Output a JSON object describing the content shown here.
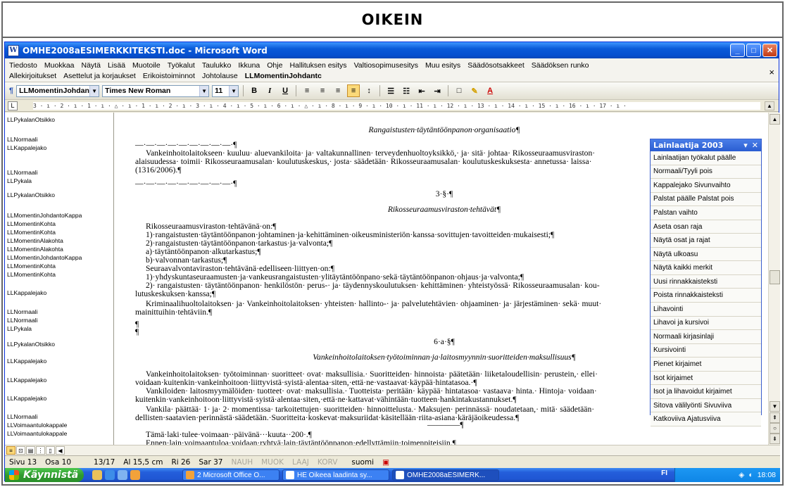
{
  "banner": {
    "title": "OIKEIN"
  },
  "window": {
    "title": "OMHE2008aESIMERKKITEKSTI.doc - Microsoft Word",
    "app_icon_letter": "W",
    "min_label": "_",
    "max_label": "□",
    "close_label": "✕"
  },
  "menu": {
    "row1": [
      "Tiedosto",
      "Muokkaa",
      "Näytä",
      "Lisää",
      "Muotoile",
      "Työkalut",
      "Taulukko",
      "Ikkuna",
      "Ohje",
      "Hallituksen esitys",
      "Valtiosopimusesitys",
      "Muu esitys",
      "Säädösotsakkeet",
      "Säädöksen runko"
    ],
    "row2": [
      "Allekirjoitukset",
      "Asettelut ja korjaukset",
      "Erikoistoiminnot",
      "Johtolause"
    ],
    "row2_style_box": "LLMomentinJohdantc",
    "close_label": "×"
  },
  "toolbar": {
    "style_value": "LLMomentinJohdantc",
    "font_value": "Times New Roman",
    "size_value": "11",
    "bold": "B",
    "italic": "I",
    "underline": "U",
    "dropdown_arrow": "▼"
  },
  "ruler": {
    "tab_selector": "L",
    "scale": "3 · ı · 2 · ı · 1 · ı · △ · ı · 1 · ı · 2 · ı · 3 · ı · 4 · ı · 5 · ı · 6 · ı · △ · ı · 8 · ı · 9 · ı · 10 · ı · 11 · ı · 12 · ı · 13 · ı · 14 · ı · 15 · ı · 16 · ı · 17 · ı ·",
    "collapse": "▲"
  },
  "styles": [
    "LLPykalanOtsikko",
    "LLNormaali",
    "LLKappalejako",
    "LLNormaali",
    "LLPykala",
    "LLPykalanOtsikko",
    "LLMomentinJohdantoKappa",
    "LLMomentinKohta",
    "LLMomentinKohta",
    "LLMomentinAlakohta",
    "LLMomentinAlakohta",
    "LLMomentinJohdantoKappa",
    "LLMomentinKohta",
    "LLMomentinKohta",
    "LLKappalejako",
    "LLNormaali",
    "LLNormaali",
    "LLPykala",
    "LLPykalanOtsikko",
    "LLKappalejako",
    "LLKappalejako",
    "LLKappalejako",
    "LLNormaali",
    "LLVoimaantulokappale",
    "LLVoimaantulokappale"
  ],
  "doc": {
    "l1": "Rangaistusten·täytäntöönpanon·organisaatio¶",
    "l2": "—·—·—·—·—·—·—·—·—·¶",
    "l3": "Vankeinhoitolaitokseen· kuuluu· aluevankiloita· ja· valtakunnallinen· terveydenhuoltoyksikkö,· ja· sitä· johtaa· Rikosseuraamusviraston·",
    "l4": "alaisuudessa· toimii· Rikosseuraamusalan· koulutuskeskus,· josta· säädetään· Rikosseuraamusalan· koulutuskeskuksesta· annetussa· laissa·",
    "l5": "(1316/2006).¶",
    "l6": "—·—·—·—·—·—·—·—·—·¶",
    "l7": "3·§·¶",
    "l8": "Rikosseuraamusviraston·tehtävät¶",
    "l9": "Rikosseuraamusviraston·tehtävänä·on:¶",
    "l10": "1)·rangaistusten·täytäntöönpanon·johtaminen·ja·kehittäminen·oikeusministeriön·kanssa·sovittujen·tavoitteiden·mukaisesti;¶",
    "l11": "2)·rangaistusten·täytäntöönpanon·tarkastus·ja·valvonta;¶",
    "l12": "a)·täytäntöönpanon·alkutarkastus;¶",
    "l13": "b)·valvonnan·tarkastus;¶",
    "l14": "Seuraavalvontaviraston·tehtävänä·edelliseen·liittyen·on:¶",
    "l15": "1)·yhdyskuntaseuraamusten·ja·vankeusrangaistusten·ylitäytäntöönpano·sekä·täytäntöönpanon·ohjaus·ja·valvonta;¶",
    "l16": "2)· rangaistusten· täytäntöönpanon· henkilöstön· perus-· ja· täydennyskoulutuksen· kehittäminen· yhteistyössä· Rikosseuraamusalan· kou-",
    "l17": "lutuskeskuksen·kanssa;¶",
    "l18": "Kriminaalihuoltolaitoksen· ja· Vankeinhoitolaitoksen· yhteisten· hallinto-· ja· palvelutehtävien· ohjaaminen· ja· järjestäminen· sekä· muut·",
    "l19": "mainittuihin·tehtäviin.¶",
    "l20": "¶",
    "l21": "¶",
    "l22": "6·a·§¶",
    "l23": "Vankeinhoitolaitoksen·työtoiminnan·ja·laitosmyynnin·suoritteiden·maksullisuus¶",
    "l24": "Vankeinhoitolaitoksen· työtoiminnan· suoritteet· ovat· maksullisia.· Suoritteiden· hinnoista· päätetään· liiketaloudellisin· perustein,· ellei·",
    "l25": "voidaan·kuitenkin·vankeinhoitoon·liittyvistä·syistä·alentaa·siten,·että·ne·vastaavat·käypää·hintatasoa.·¶",
    "l26": "Vankiloiden· laitosmyymälöiden· tuotteet· ovat· maksullisia.· Tuotteista· peritään· käypää· hintatasoa· vastaava· hinta.· Hintoja· voidaan·",
    "l27": "kuitenkin·vankeinhoitoon·liittyvistä·syistä·alentaa·siten,·että·ne·kattavat·vähintään·tuotteen·hankintakustannukset.¶",
    "l28": "Vankila· päättää· 1· ja· 2· momentissa· tarkoitettujen· suoritteiden· hinnoittelusta.· Maksujen· perinnässä· noudatetaan,· mitä· säädetään·",
    "l29": "dellisten·saatavien·perinnästä·säädetään.·Suoritteita·koskevat·maksuriidat·käsitellään·riita-asiana·käräjäoikeudessa.¶",
    "l30": "————¶",
    "l31": "Tämä·laki·tulee·voimaan··päivänä···kuuta··200·.¶",
    "l32": "Ennen·lain·voimaantuloa·voidaan·ryhtyä·lain·täytäntöönpanon·edellyttämiin·toimenpiteisiin.¶"
  },
  "panel": {
    "title": "Lainlaatija 2003",
    "buttons": [
      "Lainlaatijan työkalut päälle",
      "Normaali/Tyyli pois",
      "Kappalejako  Sivunvaihto",
      "Palstat päälle  Palstat pois",
      "Palstan vaihto",
      "Aseta osan raja",
      "Näytä osat ja rajat",
      "Näytä ulkoasu",
      "Näytä kaikki merkit",
      "Uusi rinnakkaisteksti",
      "Poista rinnakkaisteksti",
      "Lihavointi",
      "Lihavoi ja kursivoi",
      "Normaali kirjasinlaji",
      "Kursivointi",
      "Pienet kirjaimet",
      "Isot kirjaimet",
      "Isot ja lihavoidut kirjaimet",
      "Sitova välilyönti  Sivuviiva",
      "Katkoviiva  Ajatusviiva"
    ]
  },
  "status": {
    "page": "Sivu 13",
    "section": "Osa 10",
    "pages": "13/17",
    "pos": "Al 15,5 cm",
    "line": "Ri 26",
    "col": "Sar 37",
    "rec": "NAUH",
    "trk": "MUOK",
    "ext": "LAAJ",
    "ovr": "KORV",
    "lang": "suomi"
  },
  "taskbar": {
    "start": "Käynnistä",
    "tasks": [
      "2 Microsoft Office O...",
      "HE Oikeea laadinta sy...",
      "OMHE2008aESIMERK..."
    ],
    "lang": "FI",
    "clock": "18:08"
  }
}
